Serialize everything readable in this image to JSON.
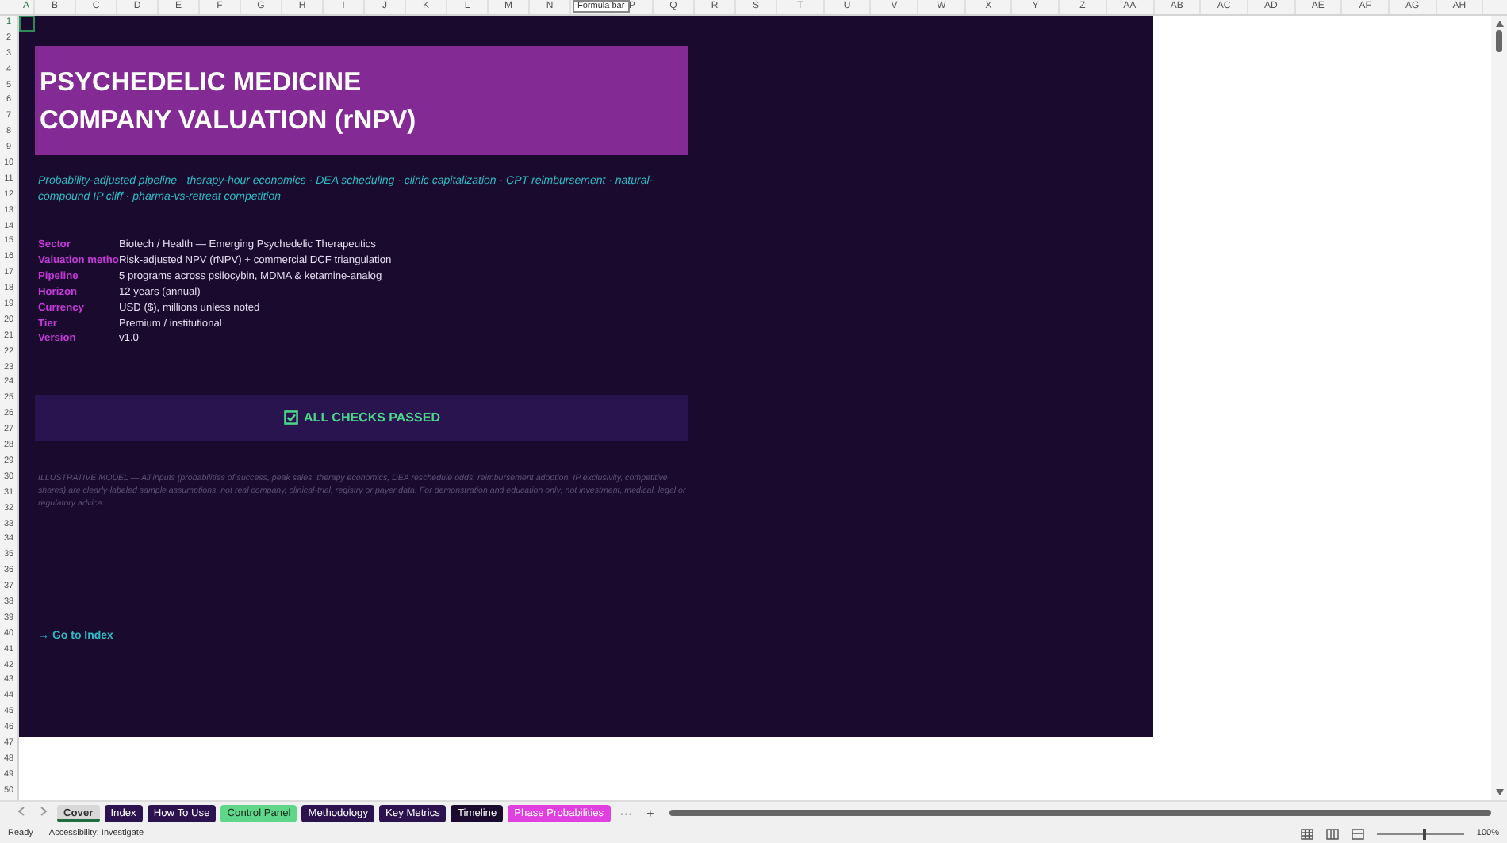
{
  "columns": [
    "A",
    "B",
    "C",
    "D",
    "E",
    "F",
    "G",
    "H",
    "I",
    "J",
    "K",
    "L",
    "M",
    "N",
    "",
    "P",
    "Q",
    "R",
    "S",
    "T",
    "U",
    "V",
    "W",
    "X",
    "Y",
    "Z",
    "AA",
    "AB",
    "AC",
    "AD",
    "AE",
    "AF",
    "AG",
    "AH"
  ],
  "tooltip": "Formula bar",
  "rows": [
    "1",
    "2",
    "3",
    "4",
    "5",
    "6",
    "7",
    "8",
    "9",
    "10",
    "11",
    "12",
    "13",
    "14",
    "15",
    "16",
    "17",
    "18",
    "19",
    "20",
    "21",
    "22",
    "23",
    "24",
    "25",
    "26",
    "27",
    "28",
    "29",
    "30",
    "31",
    "32",
    "33",
    "34",
    "35",
    "36",
    "37",
    "38",
    "39",
    "40",
    "41",
    "42",
    "43",
    "44",
    "45",
    "46",
    "47",
    "48",
    "49",
    "50"
  ],
  "title_lines": [
    "PSYCHEDELIC MEDICINE",
    "COMPANY VALUATION (rNPV)"
  ],
  "tagline": "Probability-adjusted pipeline · therapy-hour economics · DEA scheduling · clinic capitalization · CPT reimbursement · natural-compound IP cliff · pharma-vs-retreat competition",
  "details": [
    {
      "label": "Sector",
      "value": "Biotech / Health — Emerging Psychedelic Therapeutics"
    },
    {
      "label": "Valuation metho",
      "value": "Risk-adjusted NPV (rNPV) + commercial DCF triangulation"
    },
    {
      "label": "Pipeline",
      "value": "5 programs across psilocybin, MDMA & ketamine-analog"
    },
    {
      "label": "Horizon",
      "value": "12 years (annual)"
    },
    {
      "label": "Currency",
      "value": "USD ($), millions unless noted"
    },
    {
      "label": "Tier",
      "value": "Premium / institutional"
    },
    {
      "label": "Version",
      "value": "v1.0"
    }
  ],
  "check_status": {
    "label": "ALL CHECKS PASSED",
    "passed": true
  },
  "disclaimer": "ILLUSTRATIVE MODEL — All inputs (probabilities of success, peak sales, therapy economics, DEA reschedule odds, reimbursement adoption, IP exclusivity, competitive shares) are clearly-labeled sample assumptions, not real company, clinical-trial, registry or payer data. For demonstration and education only; not investment, medical, legal or regulatory advice.",
  "link": "→ Go to Index",
  "sheet_tabs": [
    {
      "label": "Cover",
      "selected": true
    },
    {
      "label": "Index",
      "selected": false,
      "color": "#2d1250"
    },
    {
      "label": "How To Use",
      "selected": false,
      "color": "#2d1250"
    },
    {
      "label": "Control Panel",
      "selected": false,
      "color": "#5fd68a"
    },
    {
      "label": "Methodology",
      "selected": false,
      "color": "#2d1250"
    },
    {
      "label": "Key Metrics",
      "selected": false,
      "color": "#2d1250"
    },
    {
      "label": "Timeline",
      "selected": false,
      "color": "#1a0a2e"
    },
    {
      "label": "Phase Probabilities",
      "selected": false,
      "color": "#e040e0"
    }
  ],
  "tab_overflow": "···",
  "tab_add": "+",
  "status_bar": {
    "status": "Ready",
    "accessibility": "Accessibility: Investigate",
    "zoom": "100%",
    "zoom_slider": {
      "level": 0.55
    }
  }
}
